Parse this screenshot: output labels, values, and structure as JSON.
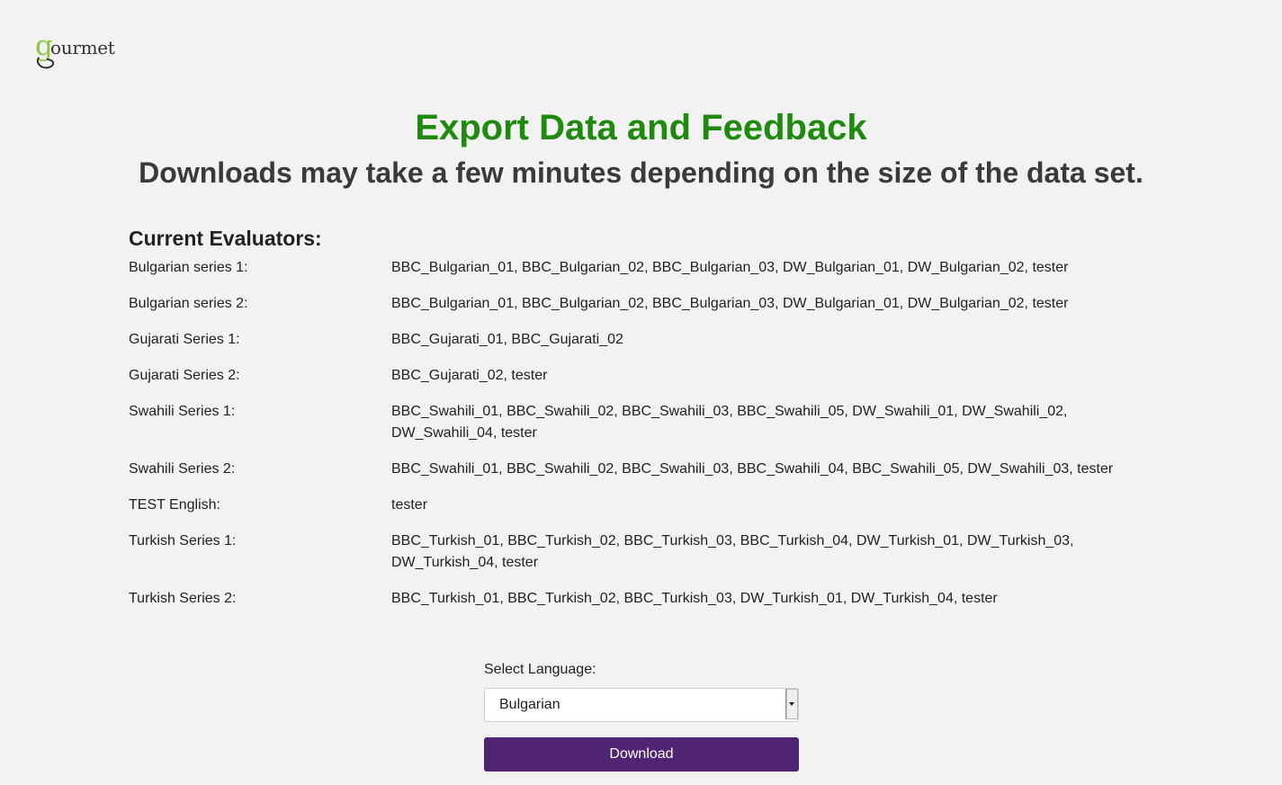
{
  "logo": {
    "first_letter": "g",
    "rest": "ourmet"
  },
  "header": {
    "title": "Export Data and Feedback",
    "subtitle": "Downloads may take a few minutes depending on the size of the data set."
  },
  "evaluators": {
    "heading": "Current Evaluators:",
    "rows": [
      {
        "label": "Bulgarian series 1:",
        "value": "BBC_Bulgarian_01, BBC_Bulgarian_02, BBC_Bulgarian_03, DW_Bulgarian_01, DW_Bulgarian_02, tester"
      },
      {
        "label": "Bulgarian series 2:",
        "value": "BBC_Bulgarian_01, BBC_Bulgarian_02, BBC_Bulgarian_03, DW_Bulgarian_01, DW_Bulgarian_02, tester"
      },
      {
        "label": "Gujarati Series 1:",
        "value": "BBC_Gujarati_01, BBC_Gujarati_02"
      },
      {
        "label": "Gujarati Series 2:",
        "value": "BBC_Gujarati_02, tester"
      },
      {
        "label": "Swahili Series 1:",
        "value": "BBC_Swahili_01, BBC_Swahili_02, BBC_Swahili_03, BBC_Swahili_05, DW_Swahili_01, DW_Swahili_02, DW_Swahili_04, tester"
      },
      {
        "label": "Swahili Series 2:",
        "value": "BBC_Swahili_01, BBC_Swahili_02, BBC_Swahili_03, BBC_Swahili_04, BBC_Swahili_05, DW_Swahili_03, tester"
      },
      {
        "label": "TEST English:",
        "value": "tester"
      },
      {
        "label": "Turkish Series 1:",
        "value": "BBC_Turkish_01, BBC_Turkish_02, BBC_Turkish_03, BBC_Turkish_04, DW_Turkish_01, DW_Turkish_03, DW_Turkish_04, tester"
      },
      {
        "label": "Turkish Series 2:",
        "value": "BBC_Turkish_01, BBC_Turkish_02, BBC_Turkish_03, DW_Turkish_01, DW_Turkish_04, tester"
      }
    ]
  },
  "form": {
    "language_label": "Select Language:",
    "selected_language": "Bulgarian",
    "download_label": "Download"
  },
  "colors": {
    "title": "#1e8a0e",
    "button": "#512472",
    "logo_accent": "#8dc63f"
  }
}
